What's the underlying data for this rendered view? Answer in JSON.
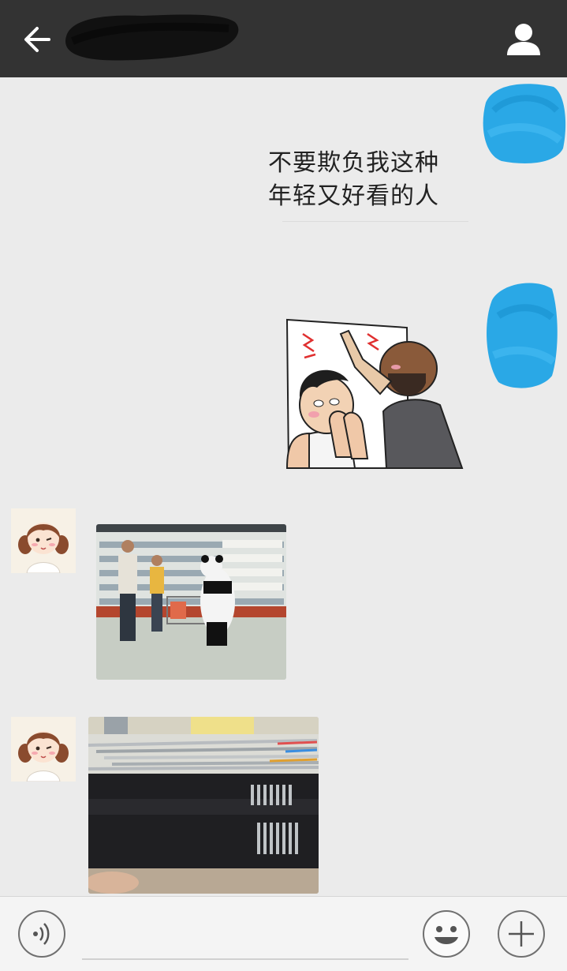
{
  "header": {
    "back_icon": "arrow-left-icon",
    "profile_icon": "person-icon",
    "title_redacted": true
  },
  "messages": [
    {
      "side": "right",
      "type": "sticker-text",
      "lines": [
        "不要欺负我这种",
        "年轻又好看的人"
      ]
    },
    {
      "side": "right",
      "type": "image",
      "content": "comic-sticker"
    },
    {
      "side": "left",
      "type": "image",
      "content": "supermarket-photo"
    },
    {
      "side": "left",
      "type": "image",
      "content": "pencils-photo"
    }
  ],
  "input_bar": {
    "voice_icon": "voice-icon",
    "emoji_icon": "smiley-icon",
    "plus_icon": "plus-icon"
  },
  "colors": {
    "header_bg": "#333333",
    "chat_bg": "#ebebeb",
    "redaction_blue": "#2aa8e6"
  }
}
